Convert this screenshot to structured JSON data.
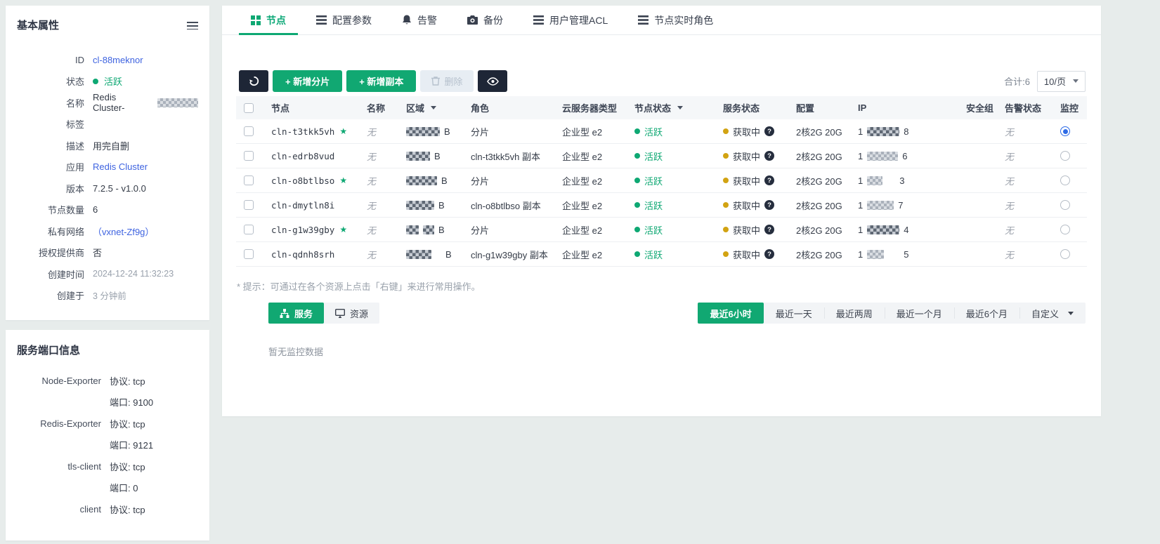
{
  "colors": {
    "accent_green": "#0ea873",
    "link_blue": "#3e63e0",
    "radio_blue": "#2e6be6",
    "pending_amber": "#d2a312",
    "dark_button": "#1e2636"
  },
  "sidebar": {
    "basic": {
      "title": "基本属性",
      "fields": [
        {
          "label": "ID",
          "value": "cl-88meknor"
        },
        {
          "label": "状态",
          "value": "活跃"
        },
        {
          "label": "名称",
          "value": "Redis Cluster-"
        },
        {
          "label": "标签",
          "value": ""
        },
        {
          "label": "描述",
          "value": "用完自删"
        },
        {
          "label": "应用",
          "value": "Redis Cluster"
        },
        {
          "label": "版本",
          "value": "7.2.5 - v1.0.0"
        },
        {
          "label": "节点数量",
          "value": "6"
        },
        {
          "label": "私有网络",
          "value": "（vxnet-Zf9g）"
        },
        {
          "label": "授权提供商",
          "value": "否"
        },
        {
          "label": "创建时间",
          "value": "2024-12-24 11:32:23"
        },
        {
          "label": "创建于",
          "value": "3 分钟前"
        }
      ]
    },
    "ports": {
      "title": "服务端口信息",
      "rows": [
        {
          "name": "Node-Exporter",
          "protocol": "协议: tcp",
          "port": "端口: 9100"
        },
        {
          "name": "Redis-Exporter",
          "protocol": "协议: tcp",
          "port": "端口: 9121"
        },
        {
          "name": "tls-client",
          "protocol": "协议: tcp",
          "port": "端口: 0"
        },
        {
          "name": "client",
          "protocol": "协议: tcp",
          "port": ""
        }
      ]
    }
  },
  "tabs": [
    {
      "label": "节点",
      "icon": "grid-icon"
    },
    {
      "label": "配置参数",
      "icon": "list-icon"
    },
    {
      "label": "告警",
      "icon": "bell-icon"
    },
    {
      "label": "备份",
      "icon": "camera-icon"
    },
    {
      "label": "用户管理ACL",
      "icon": "list-icon"
    },
    {
      "label": "节点实时角色",
      "icon": "list-icon"
    }
  ],
  "toolbar": {
    "add_shard": "+ 新增分片",
    "add_replica": "+ 新增副本",
    "delete_label": "删除",
    "total": "合计:6",
    "page_size": "10/页"
  },
  "table": {
    "headers": {
      "node": "节点",
      "name": "名称",
      "zone": "区域",
      "role": "角色",
      "server_type": "云服务器类型",
      "node_status": "节点状态",
      "service_status": "服务状态",
      "config": "配置",
      "ip": "IP",
      "security_group": "安全组",
      "alarm_status": "告警状态",
      "monitor": "监控"
    },
    "rows": [
      {
        "node": "cln-t3tkk5vh",
        "star": "★",
        "name": "无",
        "zone_suffix": "B",
        "role": "分片",
        "server_type": "企业型 e2",
        "node_status": "活跃",
        "service_status": "获取中",
        "config": "2核2G 20G",
        "ip_prefix": "1",
        "ip_suffix": "8",
        "alarm": "无"
      },
      {
        "node": "cln-edrb8vud",
        "star": "",
        "name": "无",
        "zone_suffix": "B",
        "role": "cln-t3tkk5vh 副本",
        "server_type": "企业型 e2",
        "node_status": "活跃",
        "service_status": "获取中",
        "config": "2核2G 20G",
        "ip_prefix": "1",
        "ip_suffix": "6",
        "alarm": "无"
      },
      {
        "node": "cln-o8btlbso",
        "star": "★",
        "name": "无",
        "zone_suffix": "B",
        "role": "分片",
        "server_type": "企业型 e2",
        "node_status": "活跃",
        "service_status": "获取中",
        "config": "2核2G 20G",
        "ip_prefix": "1",
        "ip_suffix": "3",
        "alarm": "无"
      },
      {
        "node": "cln-dmytln8i",
        "star": "",
        "name": "无",
        "zone_suffix": "B",
        "role": "cln-o8btlbso 副本",
        "server_type": "企业型 e2",
        "node_status": "活跃",
        "service_status": "获取中",
        "config": "2核2G 20G",
        "ip_prefix": "1",
        "ip_suffix": "7",
        "alarm": "无"
      },
      {
        "node": "cln-g1w39gby",
        "star": "★",
        "name": "无",
        "zone_suffix": "B",
        "role": "分片",
        "server_type": "企业型 e2",
        "node_status": "活跃",
        "service_status": "获取中",
        "config": "2核2G 20G",
        "ip_prefix": "1",
        "ip_suffix": "4",
        "alarm": "无"
      },
      {
        "node": "cln-qdnh8srh",
        "star": "",
        "name": "无",
        "zone_suffix": "B",
        "role": "cln-g1w39gby 副本",
        "server_type": "企业型 e2",
        "node_status": "活跃",
        "service_status": "获取中",
        "config": "2核2G 20G",
        "ip_prefix": "1",
        "ip_suffix": "5",
        "alarm": "无"
      }
    ]
  },
  "hint": "* 提示：可通过在各个资源上点击「右键」来进行常用操作。",
  "view_toggle": {
    "service": "服务",
    "resource": "资源"
  },
  "time_ranges": [
    {
      "label": "最近6小时"
    },
    {
      "label": "最近一天"
    },
    {
      "label": "最近两周"
    },
    {
      "label": "最近一个月"
    },
    {
      "label": "最近6个月"
    },
    {
      "label": "自定义"
    }
  ],
  "empty_text": "暂无监控数据"
}
